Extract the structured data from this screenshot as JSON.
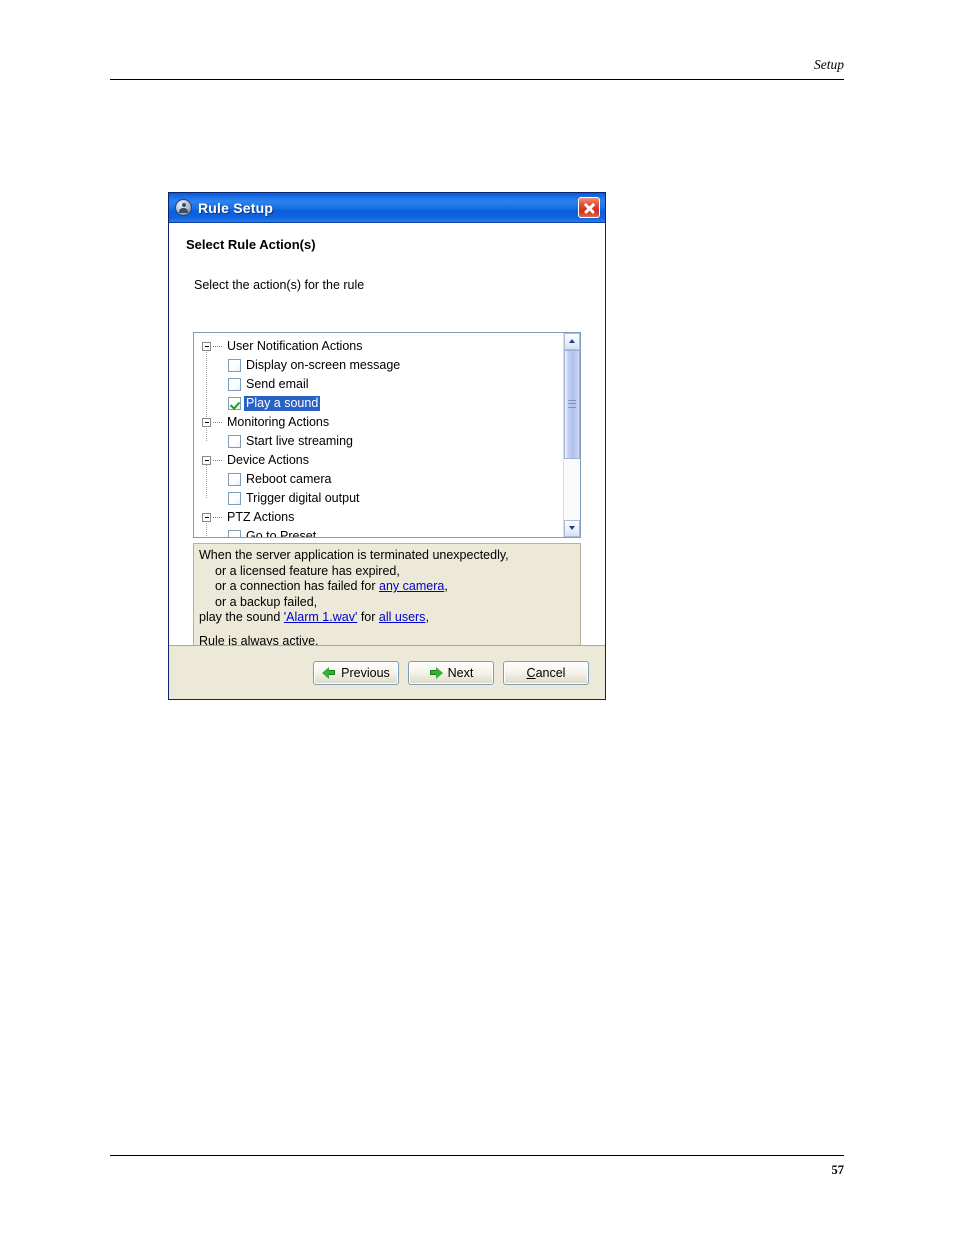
{
  "page": {
    "header_title": "Setup",
    "page_number": "57"
  },
  "dialog": {
    "title": "Rule Setup",
    "title_icon": "user-circle-icon",
    "close_icon": "close-icon",
    "step_title": "Select Rule Action(s)",
    "instruction": "Select the action(s) for the rule",
    "tree": {
      "groups": [
        {
          "label": "User Notification Actions",
          "expanded": true,
          "items": [
            {
              "label": "Display on-screen message",
              "checked": false,
              "selected": false
            },
            {
              "label": "Send email",
              "checked": false,
              "selected": false
            },
            {
              "label": "Play a sound",
              "checked": true,
              "selected": true
            }
          ]
        },
        {
          "label": "Monitoring Actions",
          "expanded": true,
          "items": [
            {
              "label": "Start live streaming",
              "checked": false,
              "selected": false
            }
          ]
        },
        {
          "label": "Device Actions",
          "expanded": true,
          "items": [
            {
              "label": "Reboot camera",
              "checked": false,
              "selected": false
            },
            {
              "label": "Trigger digital output",
              "checked": false,
              "selected": false
            }
          ]
        },
        {
          "label": "PTZ Actions",
          "expanded": true,
          "items": [
            {
              "label": "Go to Preset",
              "checked": false,
              "selected": false
            }
          ]
        }
      ],
      "scrollbar": {
        "up_icon": "chevron-up-icon",
        "down_icon": "chevron-down-icon",
        "thumb_position": "top"
      }
    },
    "description": {
      "line1": "When the server application is terminated unexpectedly,",
      "line2": "or a licensed feature has expired,",
      "line3_pre": "or a connection has failed for ",
      "line3_link": "any camera",
      "line3_post": ",",
      "line4": "or a backup failed,",
      "line5_pre": "play the sound ",
      "line5_link1": "'Alarm 1.wav'",
      "line5_mid": " for ",
      "line5_link2": "all users",
      "line5_post": ",",
      "line6": "Rule is always active."
    },
    "buttons": {
      "previous": "Previous",
      "next": "Next",
      "cancel_accel": "C",
      "cancel_rest": "ancel"
    }
  },
  "colors": {
    "titlebar_blue": "#1467e0",
    "selection_blue": "#2a62c4",
    "link_blue": "#0000cd",
    "check_green": "#17a017",
    "dialog_face": "#ece9d8",
    "close_red": "#c9301b"
  }
}
